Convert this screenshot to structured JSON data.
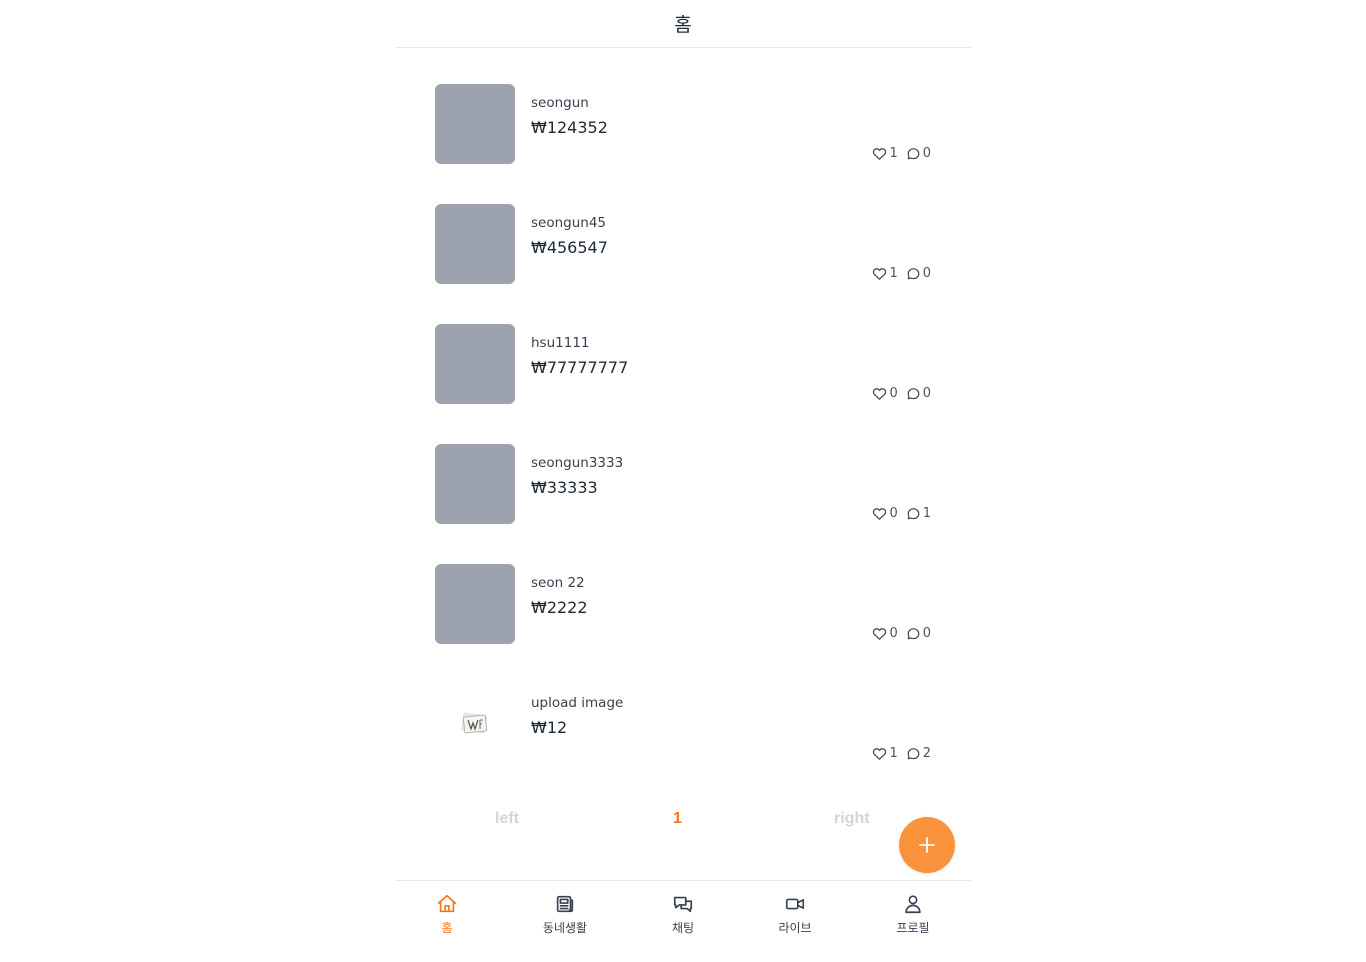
{
  "header": {
    "title": "홈"
  },
  "products": [
    {
      "seller": "seongun",
      "price": "₩124352",
      "likes": "1",
      "comments": "0",
      "thumb": "placeholder"
    },
    {
      "seller": "seongun45",
      "price": "₩456547",
      "likes": "1",
      "comments": "0",
      "thumb": "placeholder"
    },
    {
      "seller": "hsu1111",
      "price": "₩77777777",
      "likes": "0",
      "comments": "0",
      "thumb": "placeholder"
    },
    {
      "seller": "seongun3333",
      "price": "₩33333",
      "likes": "0",
      "comments": "1",
      "thumb": "placeholder"
    },
    {
      "seller": "seon 22",
      "price": "₩2222",
      "likes": "0",
      "comments": "0",
      "thumb": "placeholder"
    },
    {
      "seller": "upload image",
      "price": "₩12",
      "likes": "1",
      "comments": "2",
      "thumb": "photo"
    }
  ],
  "pagination": {
    "prev_label": "left",
    "current_page": "1",
    "next_label": "right"
  },
  "fab": {
    "icon": "plus-icon"
  },
  "tabbar": {
    "tabs": [
      {
        "label": "홈",
        "icon": "home-icon",
        "active": true
      },
      {
        "label": "동네생활",
        "icon": "newspaper-icon",
        "active": false
      },
      {
        "label": "채팅",
        "icon": "chat-bubbles-icon",
        "active": false
      },
      {
        "label": "라이브",
        "icon": "video-camera-icon",
        "active": false
      },
      {
        "label": "프로필",
        "icon": "user-icon",
        "active": false
      }
    ]
  },
  "colors": {
    "accent": "#f97316",
    "fab": "#fb923c",
    "thumb_placeholder": "#9ca3af",
    "pager_disabled": "#d1d5db"
  }
}
